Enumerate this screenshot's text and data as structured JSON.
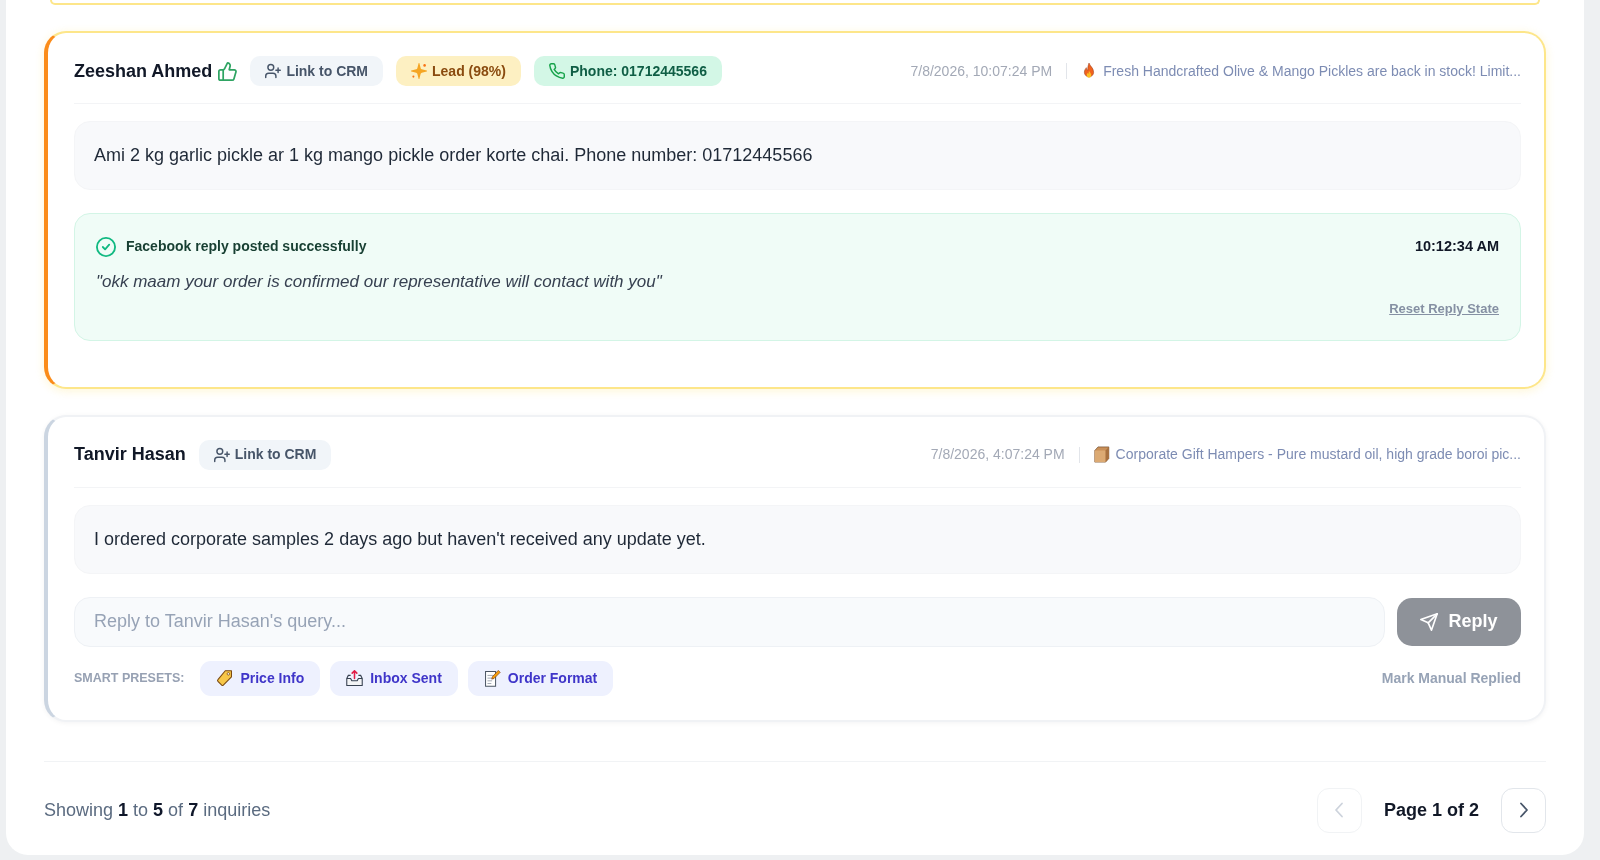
{
  "inquiries": [
    {
      "author": "Zeeshan Ahmed",
      "liked": true,
      "highlighted": true,
      "chips": [
        {
          "kind": "crm",
          "label": "Link to CRM"
        },
        {
          "kind": "lead",
          "label": "Lead (98%)"
        },
        {
          "kind": "phone",
          "label": "Phone: 01712445566"
        }
      ],
      "timestamp": "7/8/2026, 10:07:24 PM",
      "post": {
        "kind": "fire",
        "title": "Fresh Handcrafted Olive & Mango Pickles are back in stock! Limit..."
      },
      "message": "Ami 2 kg garlic pickle ar 1 kg mango pickle order korte chai. Phone number: 01712445566",
      "reply_result": {
        "status": "Facebook reply posted successfully",
        "time": "10:12:34 AM",
        "text": "\"okk maam your order is confirmed our representative will contact with you\"",
        "reset_link": "Reset Reply State"
      }
    },
    {
      "author": "Tanvir Hasan",
      "liked": false,
      "highlighted": false,
      "chips": [
        {
          "kind": "crm",
          "label": "Link to CRM"
        }
      ],
      "timestamp": "7/8/2026, 4:07:24 PM",
      "post": {
        "kind": "box",
        "title": "Corporate Gift Hampers - Pure mustard oil, high grade boroi pic..."
      },
      "message": "I ordered corporate samples 2 days ago but haven't received any update yet.",
      "reply_form": {
        "placeholder": "Reply to Tanvir Hasan's query...",
        "button": {
          "label": "Reply",
          "disabled": true
        },
        "presets_label": "SMART PRESETS:",
        "presets": [
          {
            "kind": "tag",
            "label": "Price Info"
          },
          {
            "kind": "outbox",
            "label": "Inbox Sent"
          },
          {
            "kind": "memo",
            "label": "Order Format"
          }
        ],
        "manual_link": "Mark Manual Replied"
      }
    }
  ],
  "footer": {
    "summary": "Showing **1** to **5** of **7** inquiries",
    "prev": {
      "disabled": true
    },
    "page": "Page **1** of 2",
    "next": {
      "disabled": false
    }
  }
}
